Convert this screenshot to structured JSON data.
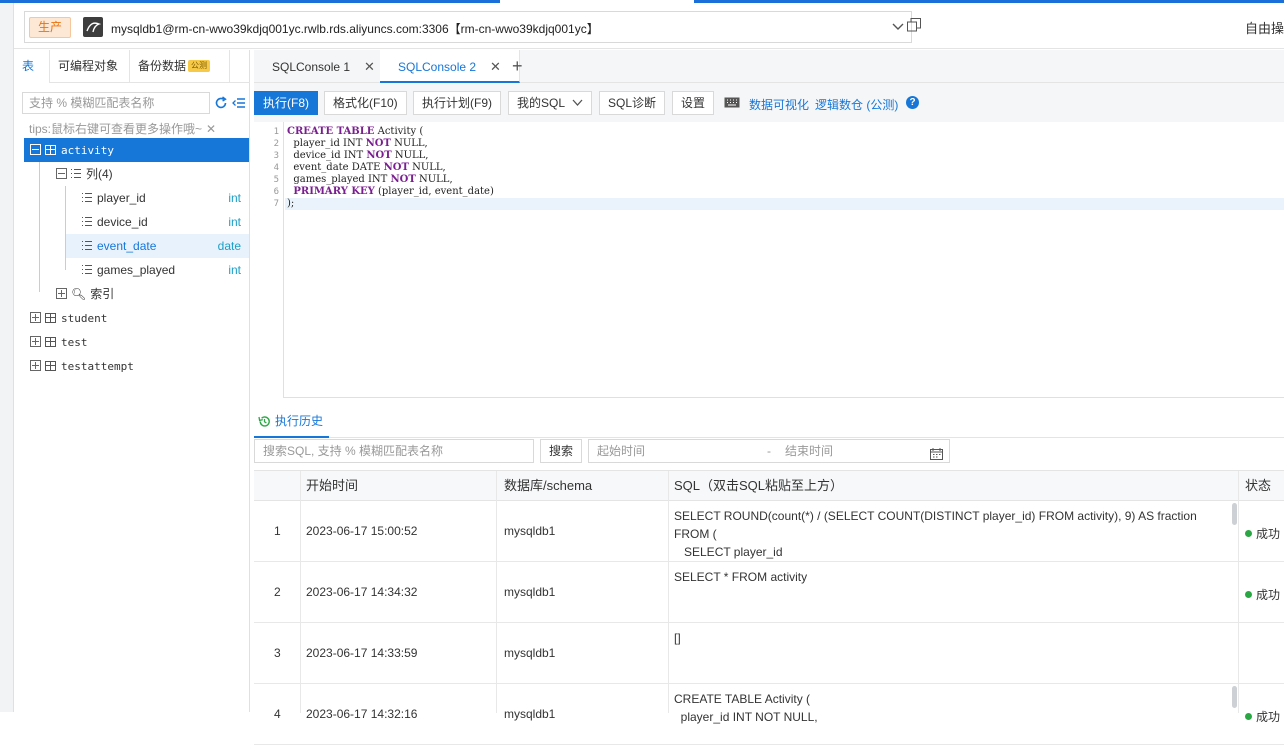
{
  "header": {
    "env_badge": "生产",
    "connection": "mysqldb1@rm-cn-wwo39kdjq001yc.rwlb.rds.aliyuncs.com:3306【rm-cn-wwo39kdjq001yc】",
    "right_text": "自由操"
  },
  "sidebar": {
    "tabs": [
      "表",
      "可编程对象",
      "备份数据"
    ],
    "beta_badge": "公测",
    "search_placeholder": "支持 % 模糊匹配表名称",
    "tips": "tips:鼠标右键可查看更多操作哦~",
    "tree": {
      "activity": "activity",
      "columns_group": "列(4)",
      "columns": [
        {
          "name": "player_id",
          "type": "int"
        },
        {
          "name": "device_id",
          "type": "int"
        },
        {
          "name": "event_date",
          "type": "date"
        },
        {
          "name": "games_played",
          "type": "int"
        }
      ],
      "index_group": "索引",
      "tables": [
        "student",
        "test",
        "testattempt"
      ]
    }
  },
  "console_tabs": [
    "SQLConsole 1",
    "SQLConsole 2"
  ],
  "toolbar": {
    "execute": "执行(F8)",
    "format": "格式化(F10)",
    "plan": "执行计划(F9)",
    "my_sql": "我的SQL",
    "diagnose": "SQL诊断",
    "settings": "设置",
    "visualize": "数据可视化",
    "logical_db": "逻辑数仓 (公测)"
  },
  "editor": {
    "line_numbers": [
      "1",
      "2",
      "3",
      "4",
      "5",
      "6",
      "7"
    ],
    "lines": [
      {
        "kw1": "CREATE TABLE",
        "rest": " Activity ("
      },
      {
        "pre": "  player_id INT ",
        "kw": "NOT",
        "post": " NULL,"
      },
      {
        "pre": "  device_id INT ",
        "kw": "NOT",
        "post": " NULL,"
      },
      {
        "pre": "  event_date DATE ",
        "kw": "NOT",
        "post": " NULL,"
      },
      {
        "pre": "  games_played INT ",
        "kw": "NOT",
        "post": " NULL,"
      },
      {
        "pre": "  ",
        "kw": "PRIMARY KEY",
        "post": " (player_id, event_date)"
      },
      {
        "pre": ");"
      }
    ]
  },
  "history": {
    "tab_label": "执行历史",
    "search_placeholder": "搜索SQL, 支持 % 模糊匹配表名称",
    "search_button": "搜索",
    "start_placeholder": "起始时间",
    "dash": "-",
    "end_placeholder": "结束时间",
    "columns": [
      "开始时间",
      "数据库/schema",
      "SQL（双击SQL粘贴至上方）",
      "状态"
    ],
    "rows": [
      {
        "idx": "1",
        "time": "2023-06-17 15:00:52",
        "db": "mysqldb1",
        "sql": "SELECT ROUND(count(*) / (SELECT COUNT(DISTINCT player_id) FROM activity), 9) AS fraction\nFROM (\n   SELECT player_id",
        "status": "成功"
      },
      {
        "idx": "2",
        "time": "2023-06-17 14:34:32",
        "db": "mysqldb1",
        "sql": "SELECT * FROM activity",
        "status": "成功"
      },
      {
        "idx": "3",
        "time": "2023-06-17 14:33:59",
        "db": "mysqldb1",
        "sql": "[]",
        "status": ""
      },
      {
        "idx": "4",
        "time": "2023-06-17 14:32:16",
        "db": "mysqldb1",
        "sql": "CREATE TABLE Activity (\n  player_id INT NOT NULL,",
        "status": "成功"
      }
    ]
  }
}
